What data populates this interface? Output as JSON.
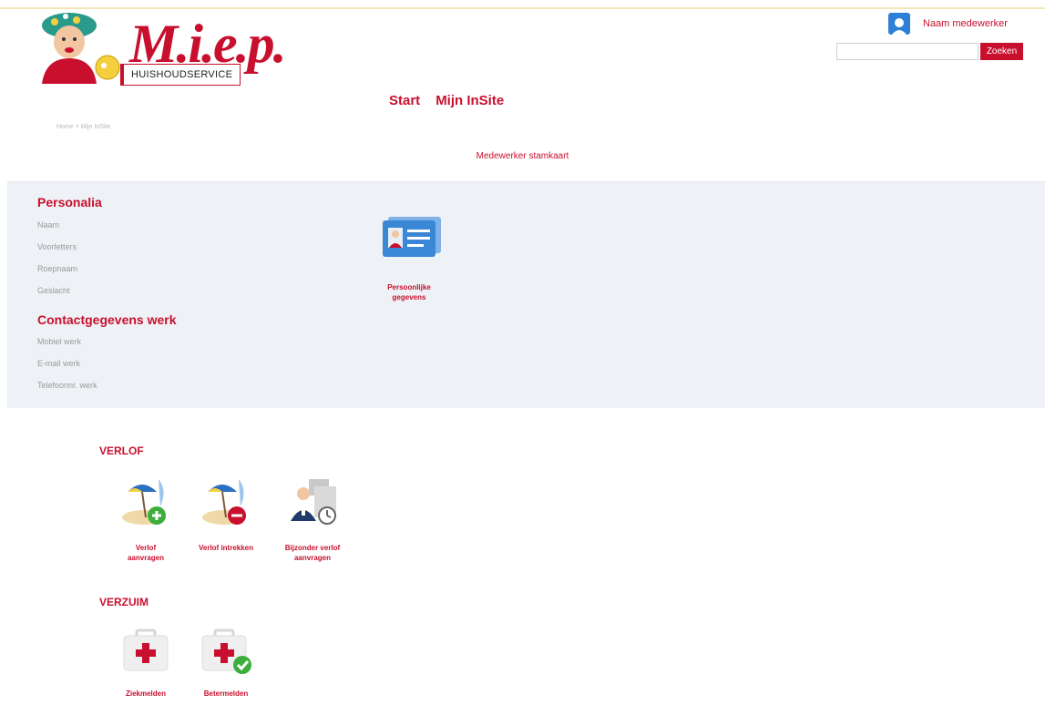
{
  "header": {
    "logo_text": "M.i.e.p.",
    "logo_sub": "HUISHOUDSERVICE",
    "user_name": "Naam medewerker",
    "search": {
      "placeholder": "",
      "value": "",
      "button_label": "Zoeken"
    }
  },
  "nav": {
    "items": [
      "Start",
      "Mijn InSite"
    ]
  },
  "breadcrumb": "Home > Mijn InSite",
  "page_title": "Medewerker stamkaart",
  "personalia": {
    "title": "Personalia",
    "fields": [
      "Naam",
      "Voorletters",
      "Roepnaam",
      "Geslacht"
    ]
  },
  "contact": {
    "title": "Contactgegevens werk",
    "fields": [
      "Mobiel werk",
      "E-mail werk",
      "Telefoonnr. werk"
    ]
  },
  "personal_tile": {
    "label_line1": "Persoonlijke",
    "label_line2": "gegevens",
    "icon": "id-card-icon"
  },
  "verlof": {
    "title": "VERLOF",
    "tiles": [
      {
        "line1": "Verlof",
        "line2": "aanvragen",
        "icon": "beach-plus-icon"
      },
      {
        "line1": "Verlof intrekken",
        "line2": "",
        "icon": "beach-minus-icon"
      },
      {
        "line1": "Bijzonder verlof",
        "line2": "aanvragen",
        "icon": "special-leave-icon"
      }
    ]
  },
  "verzuim": {
    "title": "VERZUIM",
    "tiles": [
      {
        "line1": "Ziekmelden",
        "icon": "first-aid-icon"
      },
      {
        "line1": "Betermelden",
        "icon": "first-aid-check-icon"
      }
    ]
  },
  "colors": {
    "brand": "#c8102e",
    "panel": "#eef1f5",
    "avatar": "#2e7fd6"
  }
}
